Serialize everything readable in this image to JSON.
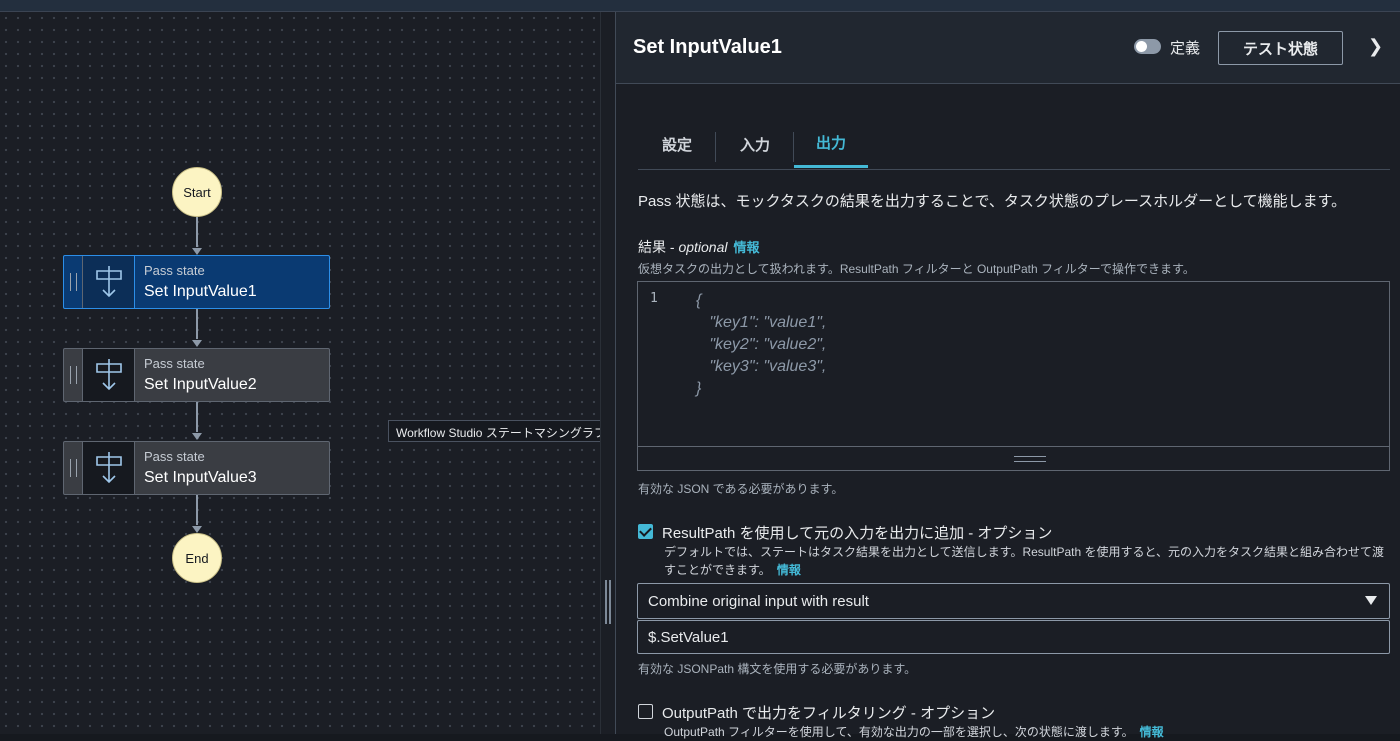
{
  "graph": {
    "start_label": "Start",
    "end_label": "End",
    "nodes": [
      {
        "kind": "Pass state",
        "name": "Set InputValue1"
      },
      {
        "kind": "Pass state",
        "name": "Set InputValue2"
      },
      {
        "kind": "Pass state",
        "name": "Set InputValue3"
      }
    ],
    "tooltip": "Workflow Studio ステートマシングラフ"
  },
  "panel": {
    "title": "Set InputValue1",
    "toggle_label": "定義",
    "test_button": "テスト状態",
    "tabs": [
      {
        "label": "設定"
      },
      {
        "label": "入力"
      },
      {
        "label": "出力"
      }
    ],
    "description": "Pass 状態は、モックタスクの結果を出力することで、タスク状態のプレースホルダーとして機能します。",
    "result": {
      "label": "結果 - ",
      "label_optional": "optional",
      "info": "情報",
      "sub": "仮想タスクの出力として扱われます。ResultPath フィルターと OutputPath フィルターで操作できます。",
      "line_number": "1",
      "code": "{\n   \"key1\": \"value1\",\n   \"key2\": \"value2\",\n   \"key3\": \"value3\",\n}",
      "hint": "有効な JSON である必要があります。"
    },
    "result_path": {
      "label": "ResultPath を使用して元の入力を出力に追加 - オプション",
      "desc": "デフォルトでは、ステートはタスク結果を出力として送信します。ResultPath を使用すると、元の入力をタスク結果と組み合わせて渡すことができます。",
      "info": "情報",
      "select_value": "Combine original input with result",
      "input_value": "$.SetValue1",
      "hint": "有効な JSONPath 構文を使用する必要があります。"
    },
    "output_path": {
      "label": "OutputPath で出力をフィルタリング - オプション",
      "desc": "OutputPath フィルターを使用して、有効な出力の一部を選択し、次の状態に渡します。",
      "info": "情報"
    }
  }
}
